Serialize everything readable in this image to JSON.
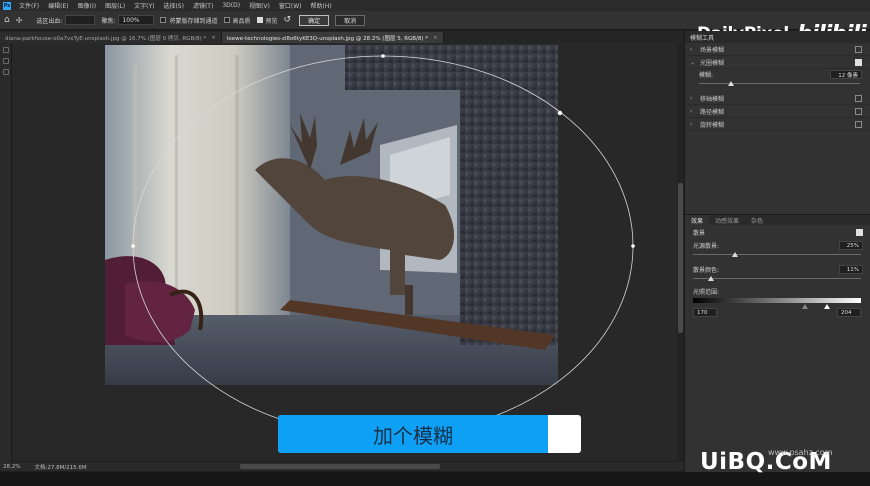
{
  "menubar": {
    "logo": "Ps",
    "items": [
      "文件(F)",
      "编辑(E)",
      "图像(I)",
      "图层(L)",
      "文字(Y)",
      "选择(S)",
      "滤镜(T)",
      "3D(D)",
      "视图(V)",
      "窗口(W)",
      "帮助(H)"
    ]
  },
  "options": {
    "select_label": "选区出血:",
    "select_value": "",
    "sharpen_label": "聚焦:",
    "sharpen_value": "100%",
    "save_mask_label": "将蒙版存储到通道",
    "high_quality_label": "高品质",
    "preview_label": "预览",
    "ok_label": "确定",
    "cancel_label": "取消"
  },
  "brand": {
    "name": "DailyPixel",
    "logo": "bilibili"
  },
  "tabs": [
    {
      "label": "diana-parkhouse-o0a7vxTyE-unsplash.jpg @ 16.7% (图层 0 拷贝, RGB/8) *",
      "active": false
    },
    {
      "label": "loewe-technologies-zi8o6tyKE3Q-unsplash.jpg @ 28.2% (图层 5, RGB/8) *",
      "active": true
    }
  ],
  "status": {
    "zoom": "28.2%",
    "doc": "文档:27.8M/215.6M"
  },
  "caption": {
    "text": "加个模糊",
    "progress": 0.89
  },
  "panel": {
    "title": "模糊工具",
    "blur_items": [
      {
        "label": "场景模糊",
        "checked": false,
        "expanded": false
      },
      {
        "label": "光圈模糊",
        "checked": true,
        "expanded": true
      },
      {
        "label": "移轴模糊",
        "checked": false,
        "expanded": false
      },
      {
        "label": "路径模糊",
        "checked": false,
        "expanded": false
      },
      {
        "label": "旋转模糊",
        "checked": false,
        "expanded": false
      }
    ],
    "blur_label": "模糊:",
    "blur_value": "12 像素",
    "blur_fraction": 0.2,
    "effect_tabs": [
      "效果",
      "动感效果",
      "杂色"
    ],
    "bokeh_label": "散景",
    "bokeh_checked": true,
    "light_bokeh_label": "光源散景:",
    "light_bokeh_value": "25%",
    "light_bokeh_fraction": 0.25,
    "bokeh_color_label": "散景颜色:",
    "bokeh_color_value": "11%",
    "bokeh_color_fraction": 0.11,
    "light_range_label": "光照范围:",
    "light_range_low": "170",
    "light_range_high": "204"
  },
  "watermark": {
    "text": "UiBQ.CoM",
    "sub": "www.psahz.com"
  }
}
